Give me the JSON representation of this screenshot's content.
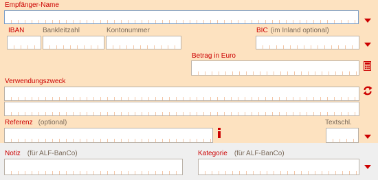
{
  "labels": {
    "empfaenger": "Empfänger-Name",
    "iban": "IBAN",
    "blz": "Bankleitzahl",
    "kontonummer": "Kontonummer",
    "bic": "BIC",
    "bic_opt": "(im Inland optional)",
    "betrag": "Betrag in Euro",
    "verwendungszweck": "Verwendungszweck",
    "referenz": "Referenz",
    "referenz_opt": "(optional)",
    "textschl": "Textschl.",
    "notiz": "Notiz",
    "notiz_opt": "(für ALF-BanCo)",
    "kategorie": "Kategorie",
    "kategorie_opt": "(für ALF-BanCo)"
  },
  "fields": {
    "empfaenger": "",
    "iban": "",
    "blz": "",
    "kontonummer": "",
    "bic": "",
    "betrag": "",
    "verwendungszweck_1": "",
    "verwendungszweck_2": "",
    "referenz": "",
    "textschl": "",
    "notiz": "",
    "kategorie": ""
  },
  "icons": {
    "dropdown": "chevron-down-icon",
    "calculator": "calculator-icon",
    "refresh": "refresh-icon",
    "info": "info-icon"
  },
  "colors": {
    "form_bg": "#fde2c0",
    "footer_bg": "#efefef",
    "label_red": "#cc0000",
    "label_grey": "#7a6a5a"
  }
}
